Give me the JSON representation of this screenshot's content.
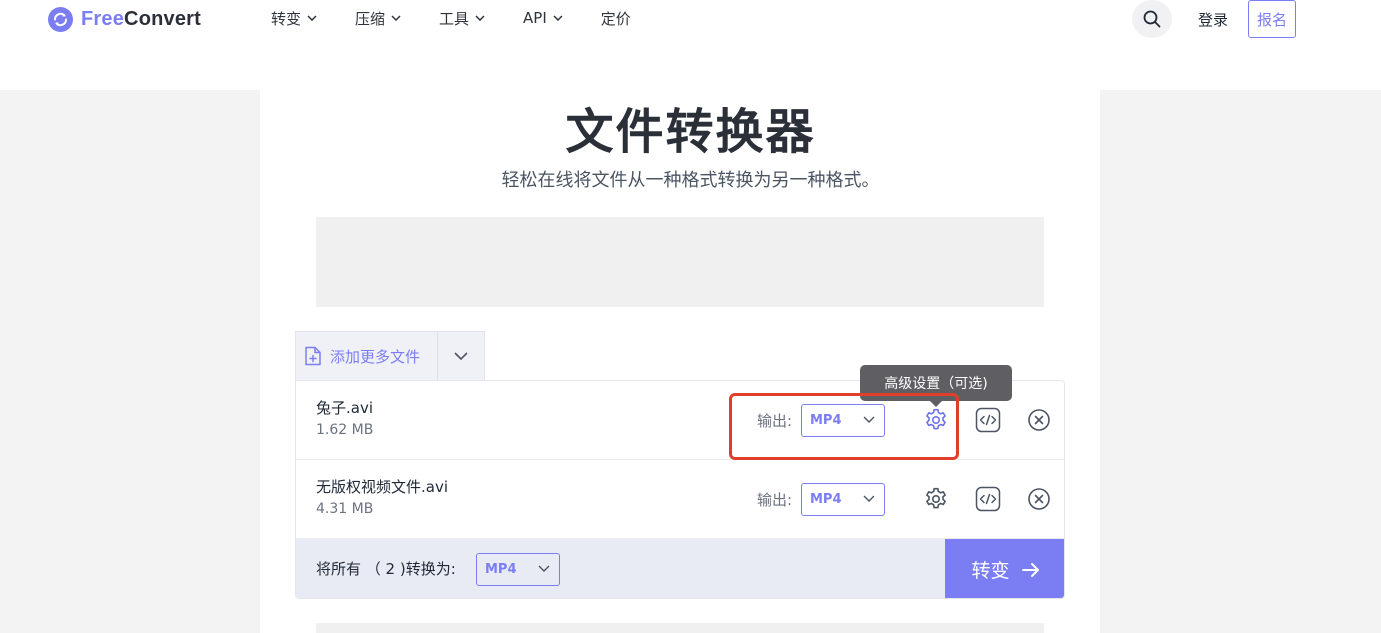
{
  "header": {
    "logo_free": "Free",
    "logo_convert": "Convert",
    "nav": [
      {
        "label": "转变",
        "has_dropdown": true
      },
      {
        "label": "压缩",
        "has_dropdown": true
      },
      {
        "label": "工具",
        "has_dropdown": true
      },
      {
        "label": "API",
        "has_dropdown": true
      },
      {
        "label": "定价",
        "has_dropdown": false
      }
    ],
    "login": "登录",
    "signup": "报名"
  },
  "hero": {
    "title": "文件转换器",
    "subtitle": "轻松在线将文件从一种格式转换为另一种格式。"
  },
  "add_files": {
    "label": "添加更多文件"
  },
  "files": [
    {
      "name": "兔子.avi",
      "size": "1.62 MB",
      "output_label": "输出:",
      "format": "MP4"
    },
    {
      "name": "无版权视频文件.avi",
      "size": "4.31 MB",
      "output_label": "输出:",
      "format": "MP4"
    }
  ],
  "footer": {
    "convert_all_label": "将所有 （ 2 )转换为:",
    "format": "MP4",
    "convert_button": "转变"
  },
  "tooltip": {
    "text": "高级设置（可选)"
  },
  "colors": {
    "accent": "#7b7ef2",
    "highlight": "#e0402a",
    "tooltip_bg": "#5f5f63"
  }
}
